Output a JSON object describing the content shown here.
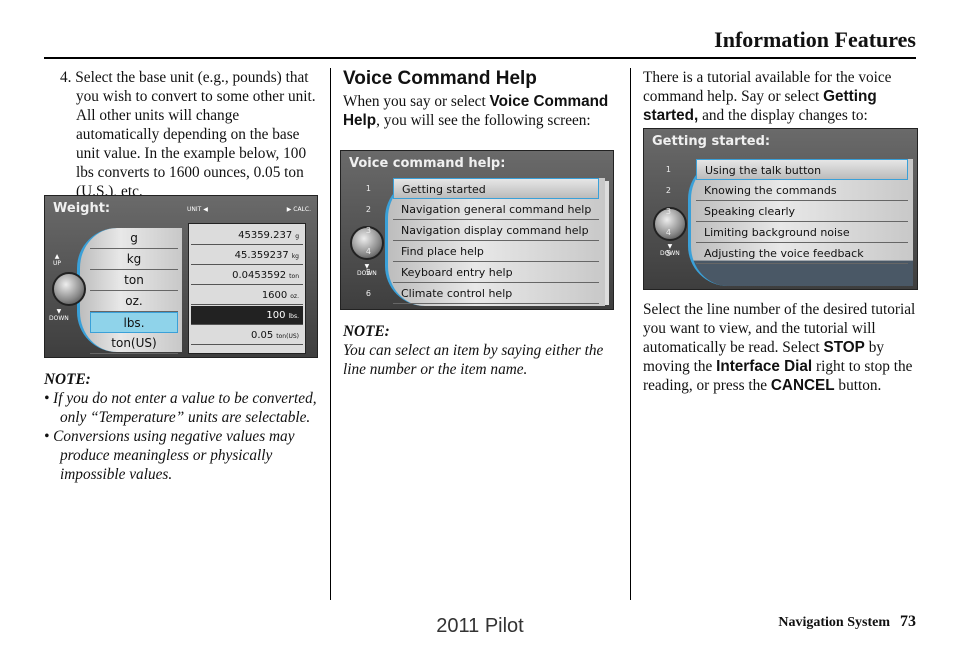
{
  "header": {
    "title": "Information Features"
  },
  "left": {
    "step": "4. Select the base unit (e.g., pounds) that you wish to convert to some other unit. All other units will change automatically depending on the base unit value. In the example below, 100 lbs converts to 1600 ounces, 0.05 ton (U.S.), etc.",
    "note_label": "NOTE:",
    "bullets": [
      "• If you do not enter a value to be converted, only “Temperature” units are selectable.",
      "• Conversions using negative values may produce meaningless or physically impossible values."
    ],
    "screen": {
      "title": "Weight:",
      "unit_label": "UNIT",
      "calc_label": "CALC.",
      "up": "UP",
      "down": "DOWN",
      "units": [
        "g",
        "kg",
        "ton",
        "oz.",
        "lbs.",
        "ton(US)"
      ],
      "selected": "lbs.",
      "values": [
        {
          "v": "45359.237",
          "u": "g"
        },
        {
          "v": "45.359237",
          "u": "kg"
        },
        {
          "v": "0.0453592",
          "u": "ton"
        },
        {
          "v": "1600",
          "u": "oz."
        },
        {
          "v": "100",
          "u": "lbs."
        },
        {
          "v": "0.05",
          "u": "ton(US)"
        }
      ]
    }
  },
  "middle": {
    "heading": "Voice Command Help",
    "p1_a": "When you say or select ",
    "p1_b": "Voice Command Help",
    "p1_c": ", you will see the following screen:",
    "note_label": "NOTE:",
    "note": "You can select an item by saying either the line number or the item name.",
    "screen": {
      "title": "Voice command help:",
      "down": "DOWN",
      "items": [
        "Getting started",
        "Navigation general command help",
        "Navigation display command help",
        "Find place help",
        "Keyboard entry help",
        "Climate control help"
      ]
    }
  },
  "right": {
    "p1_a": "There is a tutorial available for the voice command help. Say or select ",
    "p1_b": "Getting started,",
    "p1_c": " and the display changes to:",
    "p2_a": "Select the line number of the desired tutorial you want to view, and the tutorial will automatically be read. Select ",
    "p2_b": "STOP",
    "p2_c": " by moving the ",
    "p2_d": "Interface Dial",
    "p2_e": " right to stop the reading, or press the ",
    "p2_f": "CANCEL",
    "p2_g": " button.",
    "screen": {
      "title": "Getting started:",
      "down": "DOWN",
      "items": [
        "Using the talk button",
        "Knowing the commands",
        "Speaking clearly",
        "Limiting background noise",
        "Adjusting the voice feedback"
      ]
    }
  },
  "footer": {
    "section": "Navigation System",
    "page": "73",
    "watermark": "2011 Pilot"
  }
}
